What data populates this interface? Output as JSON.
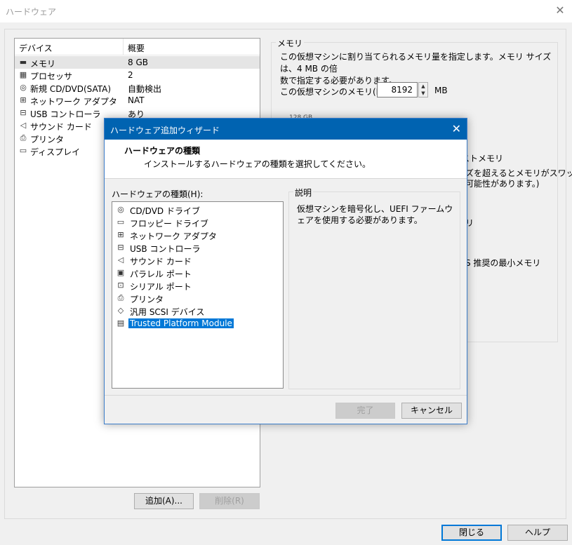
{
  "window": {
    "title": "ハードウェア",
    "close_glyph": "✕"
  },
  "device_list": {
    "col_device": "デバイス",
    "col_summary": "概要",
    "items": [
      {
        "name": "メモリ",
        "value": "8 GB",
        "icon": "memory-icon"
      },
      {
        "name": "プロセッサ",
        "value": "2",
        "icon": "processor-icon"
      },
      {
        "name": "新規 CD/DVD(SATA)",
        "value": "自動検出",
        "icon": "cd-dvd-icon"
      },
      {
        "name": "ネットワーク アダプタ",
        "value": "NAT",
        "icon": "network-adapter-icon"
      },
      {
        "name": "USB コントローラ",
        "value": "あり",
        "icon": "usb-icon"
      },
      {
        "name": "サウンド カード",
        "value": "",
        "icon": "sound-icon"
      },
      {
        "name": "プリンタ",
        "value": "",
        "icon": "printer-icon"
      },
      {
        "name": "ディスプレイ",
        "value": "",
        "icon": "display-icon"
      }
    ],
    "add_button": "追加(A)...",
    "remove_button": "削除(R)"
  },
  "memory_panel": {
    "legend": "メモリ",
    "description_line1": "この仮想マシンに割り当てられるメモリ量を指定します。メモリ サイズは、4 MB の倍",
    "description_line2": "数で指定する必要があります。",
    "vm_memory_label": "この仮想マシンのメモリ(M):",
    "vm_memory_value": "8192",
    "unit": "MB",
    "partial_scale_top": "128 GB",
    "partial_text_1": "ストメモリ",
    "partial_text_2": "ズを超えるとメモリがスワッ",
    "partial_text_3": "可能性があります。)",
    "partial_text_4": "リ",
    "partial_text_5": "S 推奨の最小メモリ"
  },
  "footer": {
    "close_button": "閉じる",
    "help_button": "ヘルプ"
  },
  "wizard": {
    "title": "ハードウェア追加ウィザード",
    "close_glyph": "✕",
    "heading": "ハードウェアの種類",
    "subheading": "インストールするハードウェアの種類を選択してください。",
    "list_label": "ハードウェアの種類(H):",
    "items": [
      {
        "label": "CD/DVD ドライブ",
        "icon": "cd-dvd-icon",
        "glyph": "◎"
      },
      {
        "label": "フロッピー ドライブ",
        "icon": "floppy-icon",
        "glyph": "▭"
      },
      {
        "label": "ネットワーク アダプタ",
        "icon": "network-adapter-icon",
        "glyph": "⊞"
      },
      {
        "label": "USB コントローラ",
        "icon": "usb-icon",
        "glyph": "⊟"
      },
      {
        "label": "サウンド カード",
        "icon": "sound-icon",
        "glyph": "◁"
      },
      {
        "label": "パラレル ポート",
        "icon": "parallel-port-icon",
        "glyph": "▣"
      },
      {
        "label": "シリアル ポート",
        "icon": "serial-port-icon",
        "glyph": "⊡"
      },
      {
        "label": "プリンタ",
        "icon": "printer-icon",
        "glyph": "⎙"
      },
      {
        "label": "汎用 SCSI デバイス",
        "icon": "scsi-icon",
        "glyph": "◇"
      },
      {
        "label": "Trusted Platform Module",
        "icon": "tpm-icon",
        "glyph": "▤",
        "selected": true
      }
    ],
    "description_legend": "説明",
    "description_text": "仮想マシンを暗号化し、UEFI ファームウェアを使用する必要があります。",
    "finish_button": "完了",
    "cancel_button": "キャンセル"
  },
  "device_glyphs": [
    "▬",
    "▦",
    "◎",
    "⊞",
    "⊟",
    "◁",
    "⎙",
    "▭"
  ]
}
